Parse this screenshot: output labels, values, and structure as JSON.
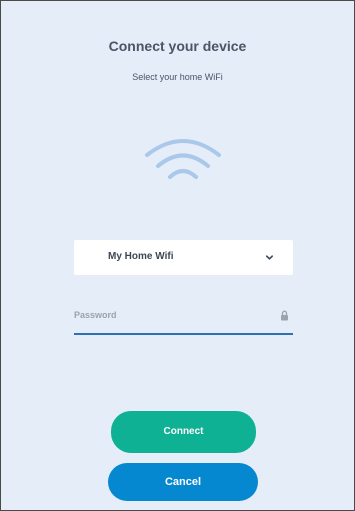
{
  "header": {
    "title": "Connect your device",
    "subtitle": "Select your home WiFi"
  },
  "wifi_icon": {
    "name": "wifi-icon",
    "color": "#a9c8ea"
  },
  "network_select": {
    "selected": "My Home Wifi",
    "icon": "chevron-down-icon"
  },
  "password": {
    "placeholder": "Password",
    "value": "",
    "icon": "lock-icon"
  },
  "actions": {
    "connect_label": "Connect",
    "cancel_label": "Cancel"
  },
  "colors": {
    "background": "#e4edf8",
    "connect": "#0fb195",
    "cancel": "#0688d0",
    "underline": "#2f6fb2"
  }
}
